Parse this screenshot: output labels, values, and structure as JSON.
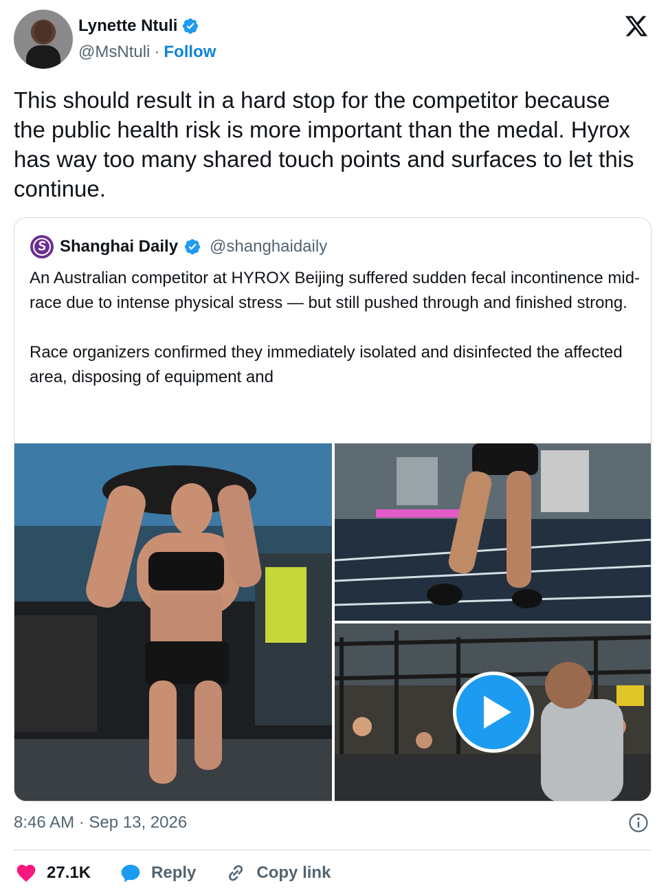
{
  "author": {
    "display_name": "Lynette Ntuli",
    "handle": "@MsNtuli",
    "separator": "·",
    "follow_label": "Follow",
    "verified": true
  },
  "tweet": {
    "text": "This should result in a hard stop for the competitor because the public health risk is more important than the medal. Hyrox has way too many shared touch points and surfaces to let this continue."
  },
  "quoted": {
    "display_name": "Shanghai Daily",
    "handle": "@shanghaidaily",
    "verified": true,
    "text": "An Australian competitor at HYROX Beijing suffered sudden fecal incontinence mid-race due to intense physical stress — but still pushed through and finished strong.\n\nRace organizers confirmed they immediately isolated and disinfected the affected area, disposing of equipment and",
    "media": [
      {
        "kind": "photo",
        "subject": "athlete-carrying-sandbag"
      },
      {
        "kind": "photo",
        "subject": "athlete-legs-on-track"
      },
      {
        "kind": "video",
        "subject": "race-hall-crowd"
      }
    ]
  },
  "meta": {
    "timestamp": "8:46 AM · Sep 13, 2026"
  },
  "actions": {
    "likes": "27.1K",
    "reply_label": "Reply",
    "copy_label": "Copy link"
  },
  "colors": {
    "accent": "#1d9bf0",
    "follow": "#0f84d4",
    "like": "#f91880",
    "muted": "#536471",
    "border": "#cfd9de"
  }
}
